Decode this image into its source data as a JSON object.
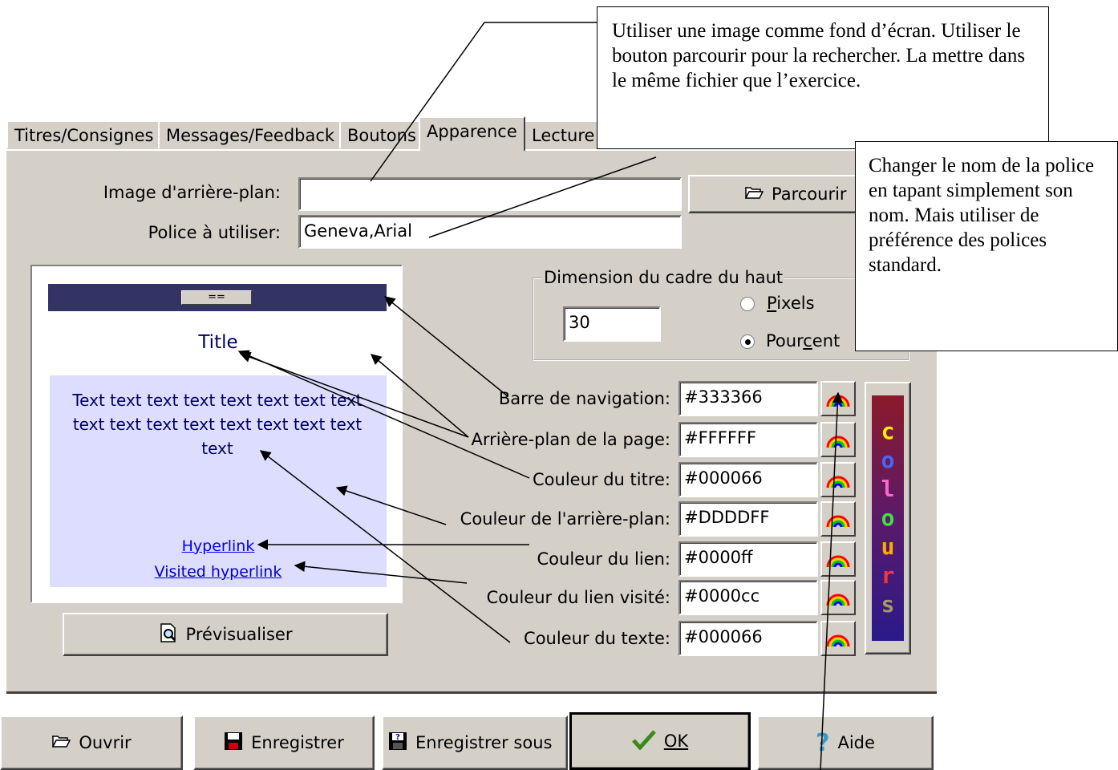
{
  "tabs": [
    {
      "label": "Titres/Consignes"
    },
    {
      "label": "Messages/Feedback"
    },
    {
      "label": "Boutons"
    },
    {
      "label": "Apparence"
    },
    {
      "label": "Lecture"
    }
  ],
  "fields": {
    "background_image_label": "Image d'arrière-plan:",
    "background_image_value": "",
    "font_label": "Police à utiliser:",
    "font_value": "Geneva,Arial",
    "browse_label": "Parcourir"
  },
  "frame": {
    "group_title": "Dimension du cadre du haut",
    "size_value": "30",
    "pixels_label": "Pixels",
    "percent_label": "Pourcent",
    "selected": "Pourcent"
  },
  "colors": [
    {
      "label": "Barre de navigation:",
      "value": "#333366"
    },
    {
      "label": "Arrière-plan de la page:",
      "value": "#FFFFFF"
    },
    {
      "label": "Couleur du titre:",
      "value": "#000066"
    },
    {
      "label": "Couleur de l'arrière-plan:",
      "value": "#DDDDFF"
    },
    {
      "label": "Couleur du lien:",
      "value": "#0000ff"
    },
    {
      "label": "Couleur du lien visité:",
      "value": "#0000cc"
    },
    {
      "label": "Couleur du texte:",
      "value": "#000066"
    }
  ],
  "preview": {
    "nav_button": "==",
    "title": "Title",
    "body_text": "Text text text text text text text text text text text text text text text text text",
    "hyperlink": "Hyperlink",
    "visited_hyperlink": "Visited hyperlink",
    "preview_button": "Prévisualiser"
  },
  "colours_logo": [
    "c",
    "o",
    "l",
    "o",
    "u",
    "r",
    "s"
  ],
  "bottom_buttons": {
    "open": "Ouvrir",
    "save": "Enregistrer",
    "save_as": "Enregistrer sous",
    "ok": "OK",
    "help": "Aide"
  },
  "callouts": {
    "image": "Utiliser une image comme fond d’écran. Utiliser le bouton parcourir pour la rechercher. La mettre dans le même fichier que l’exercice.",
    "font": "Changer le nom de la police en tapant simplement son nom. Mais utiliser de préférence des polices standard."
  }
}
